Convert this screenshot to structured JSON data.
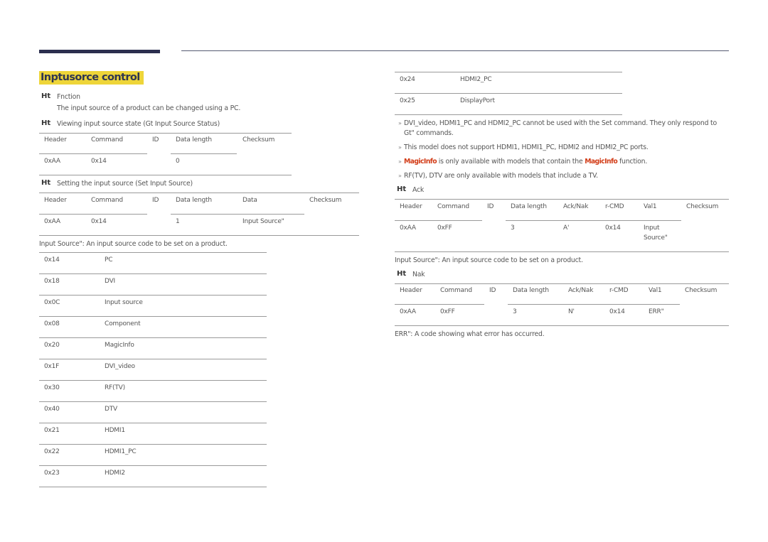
{
  "page": {
    "title": "Inptusorce control",
    "function_heading": "Fnction",
    "function_desc": "The input source of a product can be changed using a PC.",
    "ht_marker": "Ht",
    "status_heading": "Viewing input source state (Gt Input Source Status)",
    "set_heading": "Setting the input source (Set Input Source)",
    "input_source_note": "Input Source\": An input source code to be set on a product.",
    "ack_heading": "Ack",
    "nak_heading": "Nak",
    "ack_note": "Input Source\": An input source code to be set on a product.",
    "err_note": "ERR\": A code showing what error has occurred."
  },
  "status_table": {
    "headers": [
      "Header",
      "Command",
      "ID",
      "Data length",
      "Checksum"
    ],
    "row": [
      "0xAA",
      "0x14",
      "",
      "0",
      ""
    ]
  },
  "set_table": {
    "headers": [
      "Header",
      "Command",
      "ID",
      "Data length",
      "Data",
      "Checksum"
    ],
    "row": [
      "0xAA",
      "0x14",
      "",
      "1",
      "Input Source\"",
      ""
    ]
  },
  "source_codes": [
    {
      "code": "0x14",
      "name": "PC"
    },
    {
      "code": "0x18",
      "name": "DVI"
    },
    {
      "code": "0x0C",
      "name": "Input source"
    },
    {
      "code": "0x08",
      "name": "Component"
    },
    {
      "code": "0x20",
      "name": "MagicInfo"
    },
    {
      "code": "0x1F",
      "name": "DVI_video"
    },
    {
      "code": "0x30",
      "name": "RF(TV)"
    },
    {
      "code": "0x40",
      "name": "DTV"
    },
    {
      "code": "0x21",
      "name": "HDMI1"
    },
    {
      "code": "0x22",
      "name": "HDMI1_PC"
    },
    {
      "code": "0x23",
      "name": "HDMI2"
    },
    {
      "code": "0x24",
      "name": "HDMI2_PC"
    },
    {
      "code": "0x25",
      "name": "DisplayPort"
    }
  ],
  "notes": {
    "n1_a": "DVI_video, HDMI1_PC and HDMI2_PC cannot be used with the Set command. They only respond to",
    "n1_b": "Gt\" commands.",
    "n2": "This model does not support HDMI1, HDMI1_PC, HDMI2 and HDMI2_PC ports.",
    "n3_red": "MagicInfo",
    "n3_mid": " is only available with models that contain the ",
    "n3_red2": "MagicInfo",
    "n3_end": " function.",
    "n4": "RF(TV), DTV are only available with models that include a TV."
  },
  "ack_table": {
    "headers": [
      "Header",
      "Command",
      "ID",
      "Data length",
      "Ack/Nak",
      "r-CMD",
      "Val1",
      "Checksum"
    ],
    "row": [
      "0xAA",
      "0xFF",
      "",
      "3",
      "A'",
      "0x14",
      "Input",
      ""
    ],
    "row_val1_line2": "Source\""
  },
  "nak_table": {
    "headers": [
      "Header",
      "Command",
      "ID",
      "Data length",
      "Ack/Nak",
      "r-CMD",
      "Val1",
      "Checksum"
    ],
    "row": [
      "0xAA",
      "0xFF",
      "",
      "3",
      "N'",
      "0x14",
      "ERR\"",
      ""
    ]
  },
  "colors": {
    "title_bg": "#eed539",
    "title_fg": "#2f3650",
    "accent_red": "#d23b16",
    "topbar": "#2c2f4f"
  }
}
